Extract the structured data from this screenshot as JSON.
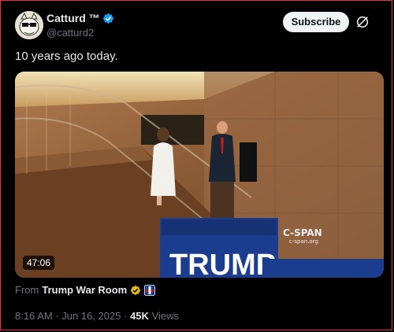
{
  "author": {
    "display_name": "Catturd ™",
    "handle": "@catturd2",
    "verified_color": "#1d9bf0"
  },
  "actions": {
    "subscribe_label": "Subscribe",
    "grok_icon": "grok-icon"
  },
  "tweet": {
    "text": "10 years ago today."
  },
  "media": {
    "duration": "47:06",
    "watermark": "C-SPAN",
    "watermark_sub": "c-span.org",
    "sign_text": "TRUMP"
  },
  "source": {
    "prefix": "From",
    "name": "Trump War Room",
    "badge_color": "#e2b719"
  },
  "meta": {
    "time": "8:16 AM",
    "separator": "·",
    "date": "Jun 16, 2025",
    "views_count": "45K",
    "views_label": "Views"
  }
}
